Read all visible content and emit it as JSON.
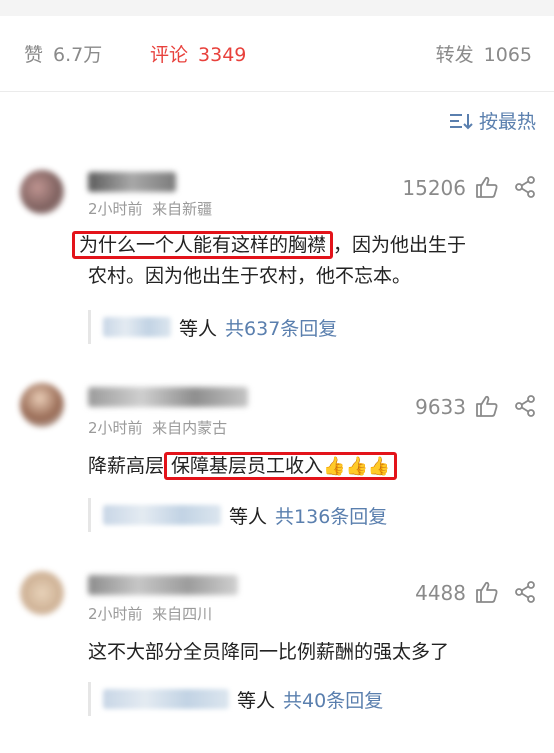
{
  "tabs": {
    "like": {
      "label": "赞",
      "count": "6.7万"
    },
    "comment": {
      "label": "评论",
      "count": "3349"
    },
    "forward": {
      "label": "转发",
      "count": "1065"
    }
  },
  "sort": {
    "label": "按最热",
    "icon": "sort-lines-icon"
  },
  "comments": [
    {
      "time": "2小时前",
      "location": "来自新疆",
      "likes": "15206",
      "text_highlight": "为什么一个人能有这样的胸襟",
      "text_rest_1": "，因为他出生于",
      "text_line2": "农村。因为他出生于农村，他不忘本。",
      "reply_who": "等人",
      "reply_count": "共637条回复"
    },
    {
      "time": "2小时前",
      "location": "来自内蒙古",
      "likes": "9633",
      "text_pre": "降薪高层",
      "text_highlight": "保障基层员工收入",
      "emoji": "👍👍👍",
      "reply_who": "等人",
      "reply_count": "共136条回复"
    },
    {
      "time": "2小时前",
      "location": "来自四川",
      "likes": "4488",
      "text": "这不大部分全员降同一比例薪酬的强太多了",
      "reply_who": "等人",
      "reply_count": "共40条回复"
    }
  ],
  "colors": {
    "accent": "#e8413c",
    "link": "#5a7fae",
    "highlight_box": "#e3131a"
  }
}
